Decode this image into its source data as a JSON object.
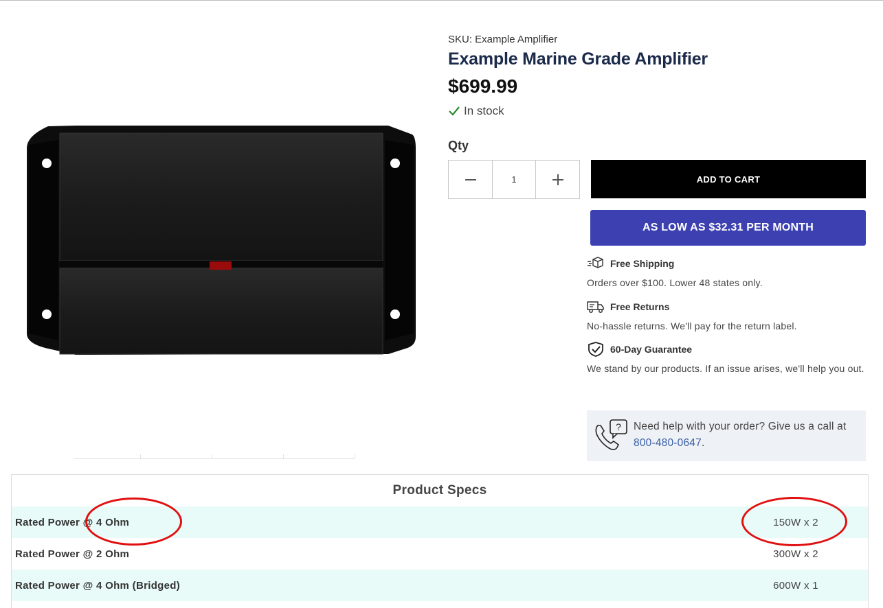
{
  "product": {
    "sku": "SKU: Example Amplifier",
    "title": "Example Marine Grade Amplifier",
    "price": "$699.99",
    "stock": "In stock",
    "qty_label": "Qty",
    "qty_value": "1",
    "add_to_cart": "ADD TO CART",
    "finance": "AS LOW AS $32.31 PER MONTH"
  },
  "perks": [
    {
      "title": "Free Shipping",
      "desc": "Orders over $100. Lower 48 states only.",
      "icon": "box-shipping-icon"
    },
    {
      "title": "Free Returns",
      "desc": "No-hassle returns. We'll pay for the return label.",
      "icon": "delivery-truck-icon"
    },
    {
      "title": "60-Day Guarantee",
      "desc": "We stand by our products. If an issue arises, we'll help you out.",
      "icon": "shield-check-icon"
    }
  ],
  "help": {
    "text": "Need help with your order? Give us a call at ",
    "phone": "800-480-0647",
    "suffix": "."
  },
  "specs": {
    "title": "Product Specs",
    "rows": [
      {
        "label": "Rated Power @ 4 Ohm",
        "value": "150W x 2"
      },
      {
        "label": "Rated Power @ 2 Ohm",
        "value": "300W x 2"
      },
      {
        "label": "Rated Power @ 4 Ohm (Bridged)",
        "value": "600W x 1"
      }
    ]
  },
  "colors": {
    "title": "#1b2a4a",
    "finance_button": "#3c40b0",
    "stock_check": "#2a8a2a",
    "spec_row_alt": "#e8fbf8",
    "annotation": "#e01010"
  }
}
